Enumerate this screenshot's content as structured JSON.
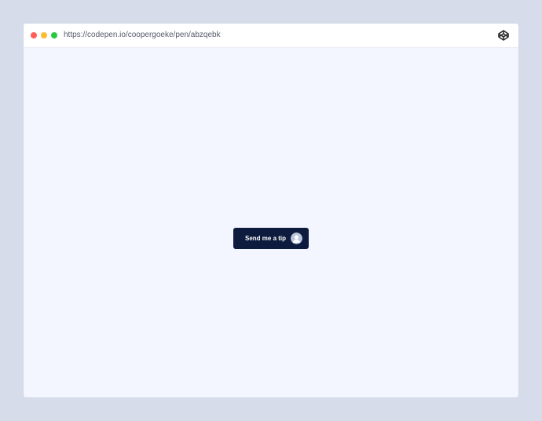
{
  "browser": {
    "url": "https://codepen.io/coopergoeke/pen/abzqebk",
    "codepen_icon": "codepen-icon"
  },
  "button": {
    "label": "Send me a tip",
    "avatar_icon": "avatar-icon"
  },
  "colors": {
    "page_background": "#d6dcea",
    "window_background": "#f3f6fe",
    "titlebar_background": "#ffffff",
    "traffic_red": "#ff5f57",
    "traffic_yellow": "#febc2e",
    "traffic_green": "#28c840",
    "button_background": "#0d1b3e",
    "avatar_background": "#b9c4dd"
  }
}
